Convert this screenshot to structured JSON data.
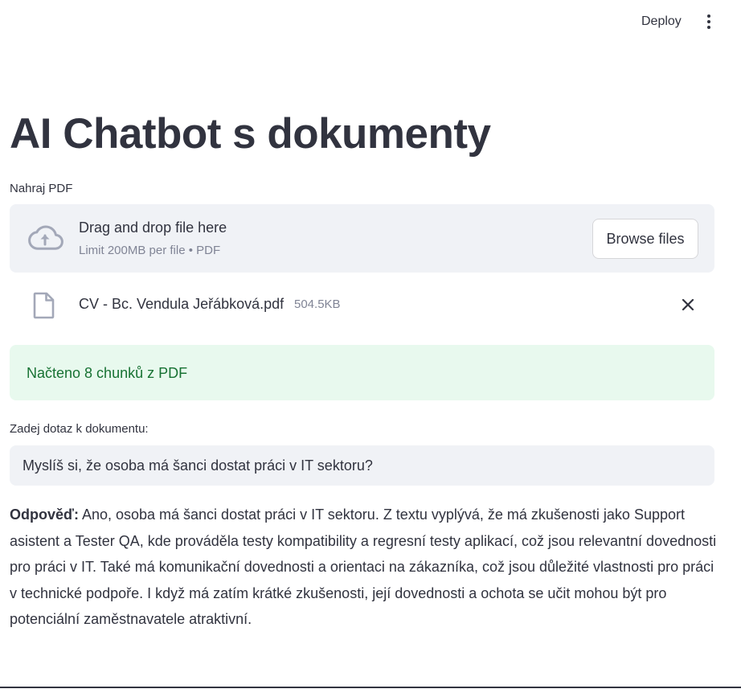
{
  "header": {
    "deploy_label": "Deploy",
    "menu_icon": "more-vertical-icon"
  },
  "main": {
    "title": "AI Chatbot s dokumenty",
    "uploader": {
      "label": "Nahraj PDF",
      "drop_title": "Drag and drop file here",
      "drop_subtitle": "Limit 200MB per file • PDF",
      "browse_label": "Browse files",
      "upload_icon": "cloud-upload-icon"
    },
    "uploaded_file": {
      "name": "CV - Bc. Vendula Jeřábková.pdf",
      "size": "504.5KB",
      "file_icon": "file-icon",
      "remove_icon": "close-icon"
    },
    "success_message": "Načteno 8 chunků z PDF",
    "query": {
      "label": "Zadej dotaz k dokumentu:",
      "value": "Myslíš si, že osoba má šanci dostat práci v IT sektoru?"
    },
    "answer": {
      "prefix": "Odpověď:",
      "text": " Ano, osoba má šanci dostat práci v IT sektoru. Z textu vyplývá, že má zkušenosti jako Support asistent a Tester QA, kde prováděla testy kompatibility a regresní testy aplikací, což jsou relevantní dovednosti pro práci v IT. Také má komunikační dovednosti a orientaci na zákazníka, což jsou důležité vlastnosti pro práci v technické podpoře. I když má zatím krátké zkušenosti, její dovednosti a ochota se učit mohou být pro potenciální zaměstnavatele atraktivní."
    }
  },
  "colors": {
    "text": "#31333f",
    "muted": "#808495",
    "panel": "#f0f2f6",
    "success_bg": "#e8f9ee",
    "success_text": "#177233"
  }
}
